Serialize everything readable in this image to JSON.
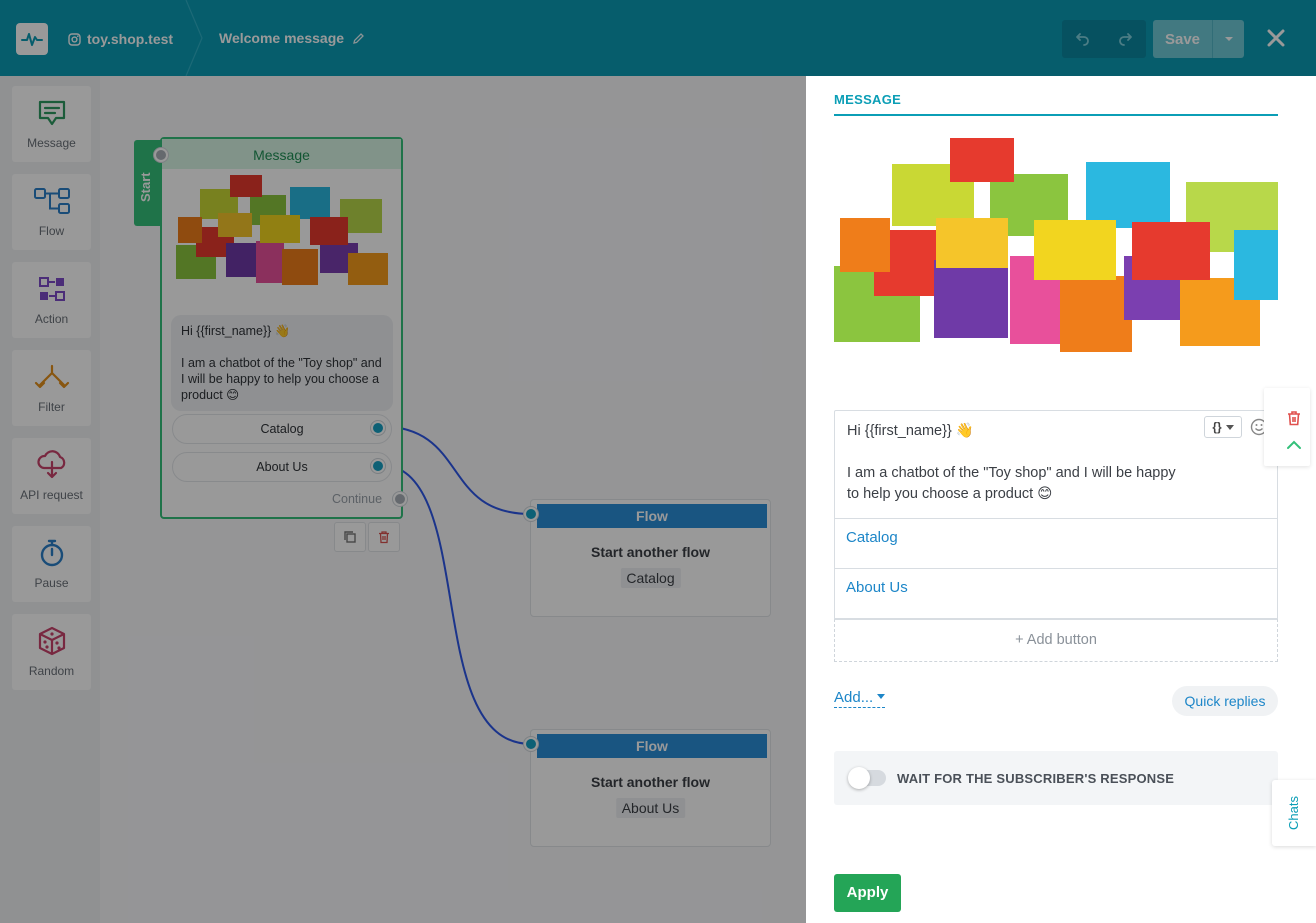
{
  "header": {
    "account": "toy.shop.test",
    "flow_name": "Welcome message",
    "save_label": "Save"
  },
  "toolbar": {
    "items": [
      {
        "label": "Message",
        "icon": "message-icon",
        "color": "#2e9a62"
      },
      {
        "label": "Flow",
        "icon": "flow-icon",
        "color": "#2a7fc9"
      },
      {
        "label": "Action",
        "icon": "action-icon",
        "color": "#7e4cc9"
      },
      {
        "label": "Filter",
        "icon": "filter-icon",
        "color": "#e38f1c"
      },
      {
        "label": "API request",
        "icon": "api-cloud-icon",
        "color": "#c9436b"
      },
      {
        "label": "Pause",
        "icon": "stopwatch-icon",
        "color": "#2a7fc9"
      },
      {
        "label": "Random",
        "icon": "dice-icon",
        "color": "#c9436b"
      }
    ]
  },
  "canvas": {
    "start_label": "Start",
    "message_node": {
      "title": "Message",
      "text_line1": "Hi {{first_name}} 👋",
      "text_line2": "I am a chatbot of the \"Toy shop\" and I will be happy to help you choose a product 😊",
      "buttons": [
        "Catalog",
        "About Us"
      ],
      "continue_label": "Continue"
    },
    "flow_nodes": [
      {
        "title": "Flow",
        "text": "Start another flow",
        "chip": "Catalog"
      },
      {
        "title": "Flow",
        "text": "Start another flow",
        "chip": "About Us"
      }
    ]
  },
  "panel": {
    "title": "MESSAGE",
    "text_line1": "Hi {{first_name}} 👋",
    "text_line2": "I am a chatbot of the \"Toy shop\" and I will be happy",
    "text_line3": "to help you choose a product 😊",
    "variables_label": "{}",
    "buttons": [
      "Catalog",
      "About Us"
    ],
    "add_button_label": "+ Add button",
    "add_label": "Add...",
    "quick_replies_label": "Quick replies",
    "wait_label": "WAIT FOR THE SUBSCRIBER'S RESPONSE",
    "chats_label": "Chats",
    "apply_label": "Apply"
  },
  "colors": {
    "header": "#0a9cb5",
    "message_green": "#34c07a",
    "flow_blue": "#2a8ed8",
    "link_blue": "#1d86c8",
    "apply_green": "#24a557"
  }
}
